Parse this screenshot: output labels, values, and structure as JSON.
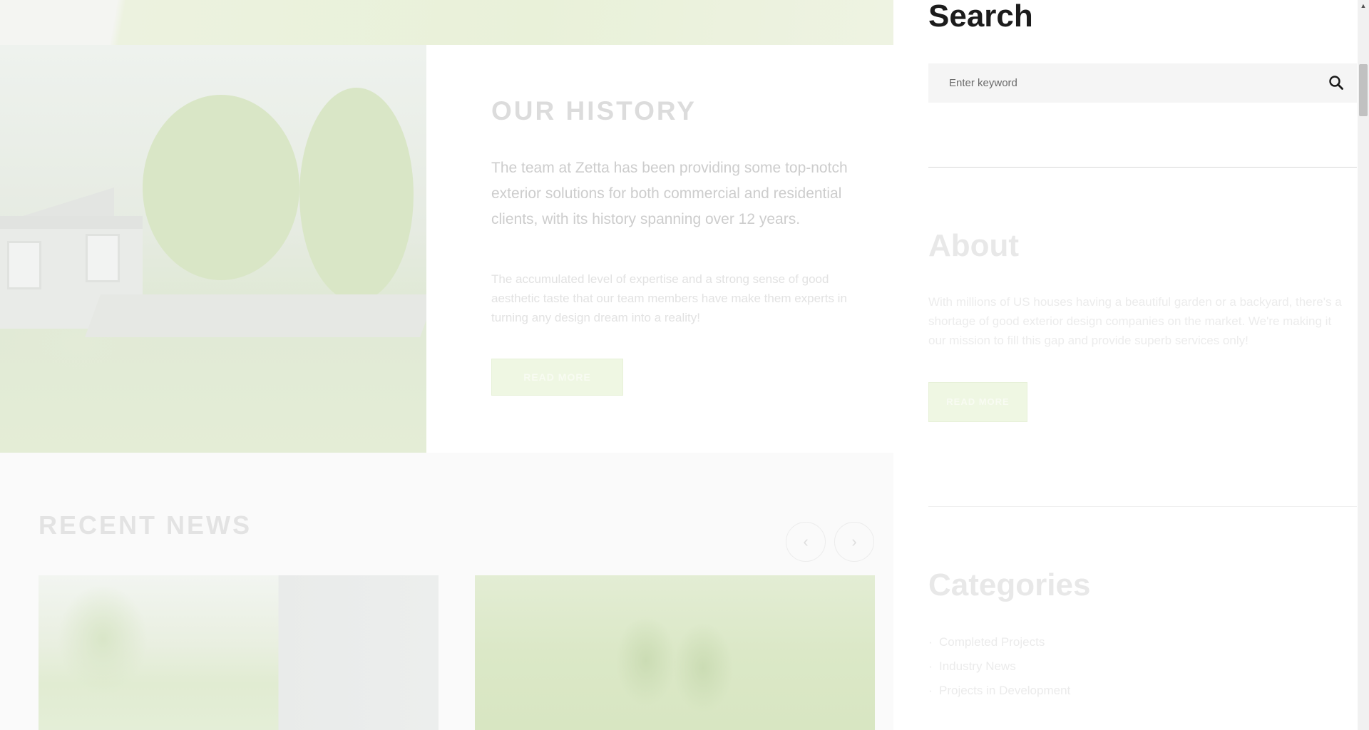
{
  "history": {
    "title": "OUR HISTORY",
    "lead": "The team at Zetta has been providing some top-notch exterior solutions for both commercial and residential clients, with its history spanning over 12 years.",
    "body": "The accumulated level of expertise and a strong sense of good aesthetic taste that our team members have make them experts in turning any design dream into a reality!",
    "button_label": "READ MORE"
  },
  "news": {
    "title": "RECENT NEWS",
    "prev_icon": "‹",
    "next_icon": "›"
  },
  "sidebar": {
    "search": {
      "heading": "Search",
      "placeholder": "Enter keyword",
      "icon": "search-icon"
    },
    "about": {
      "heading": "About",
      "text": "With millions of US houses having a beautiful garden or a backyard, there's a shortage of good exterior design companies on the market. We're making it our mission to fill this gap and provide superb services only!",
      "button_label": "READ MORE"
    },
    "categories": {
      "heading": "Categories",
      "items": [
        {
          "label": "Completed Projects"
        },
        {
          "label": "Industry News"
        },
        {
          "label": "Projects in Development"
        }
      ]
    }
  },
  "colors": {
    "accent_green": "#eff7e3",
    "heading_dark": "#1c1c1c"
  }
}
